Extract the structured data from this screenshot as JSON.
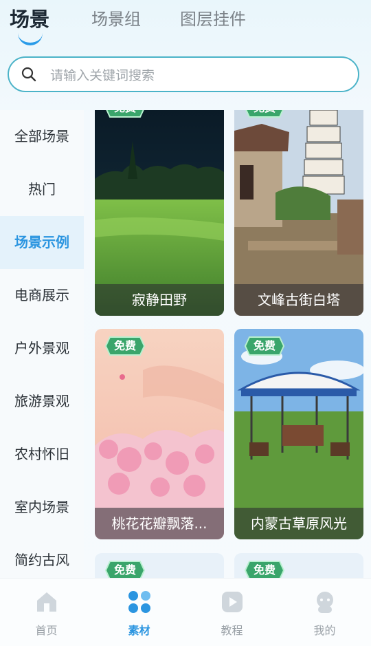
{
  "header": {
    "tabs": [
      {
        "label": "场景"
      },
      {
        "label": "场景组"
      },
      {
        "label": "图层挂件"
      }
    ]
  },
  "search": {
    "placeholder": "请输入关键词搜索",
    "value": ""
  },
  "sidebar": {
    "items": [
      {
        "label": "全部场景"
      },
      {
        "label": "热门"
      },
      {
        "label": "场景示例"
      },
      {
        "label": "电商展示"
      },
      {
        "label": "户外景观"
      },
      {
        "label": "旅游景观"
      },
      {
        "label": "农村怀旧"
      },
      {
        "label": "室内场景"
      },
      {
        "label": "简约古风"
      }
    ],
    "active": "场景示例"
  },
  "cards": [
    {
      "title": "寂静田野",
      "badge": "免费"
    },
    {
      "title": "文峰古街白塔",
      "badge": "免费"
    },
    {
      "title": "桃花花瓣飘落...",
      "badge": "免费"
    },
    {
      "title": "内蒙古草原风光",
      "badge": "免费"
    },
    {
      "title": "",
      "badge": "免费"
    },
    {
      "title": "",
      "badge": "免费"
    }
  ],
  "bottom_nav": {
    "items": [
      {
        "label": "首页",
        "icon": "home-icon"
      },
      {
        "label": "素材",
        "icon": "grid-icon"
      },
      {
        "label": "教程",
        "icon": "play-icon"
      },
      {
        "label": "我的",
        "icon": "profile-icon"
      }
    ],
    "active": "素材"
  },
  "colors": {
    "accent": "#2b95e0",
    "badge": "#3aa56b",
    "search_border": "#4bb3c8"
  }
}
